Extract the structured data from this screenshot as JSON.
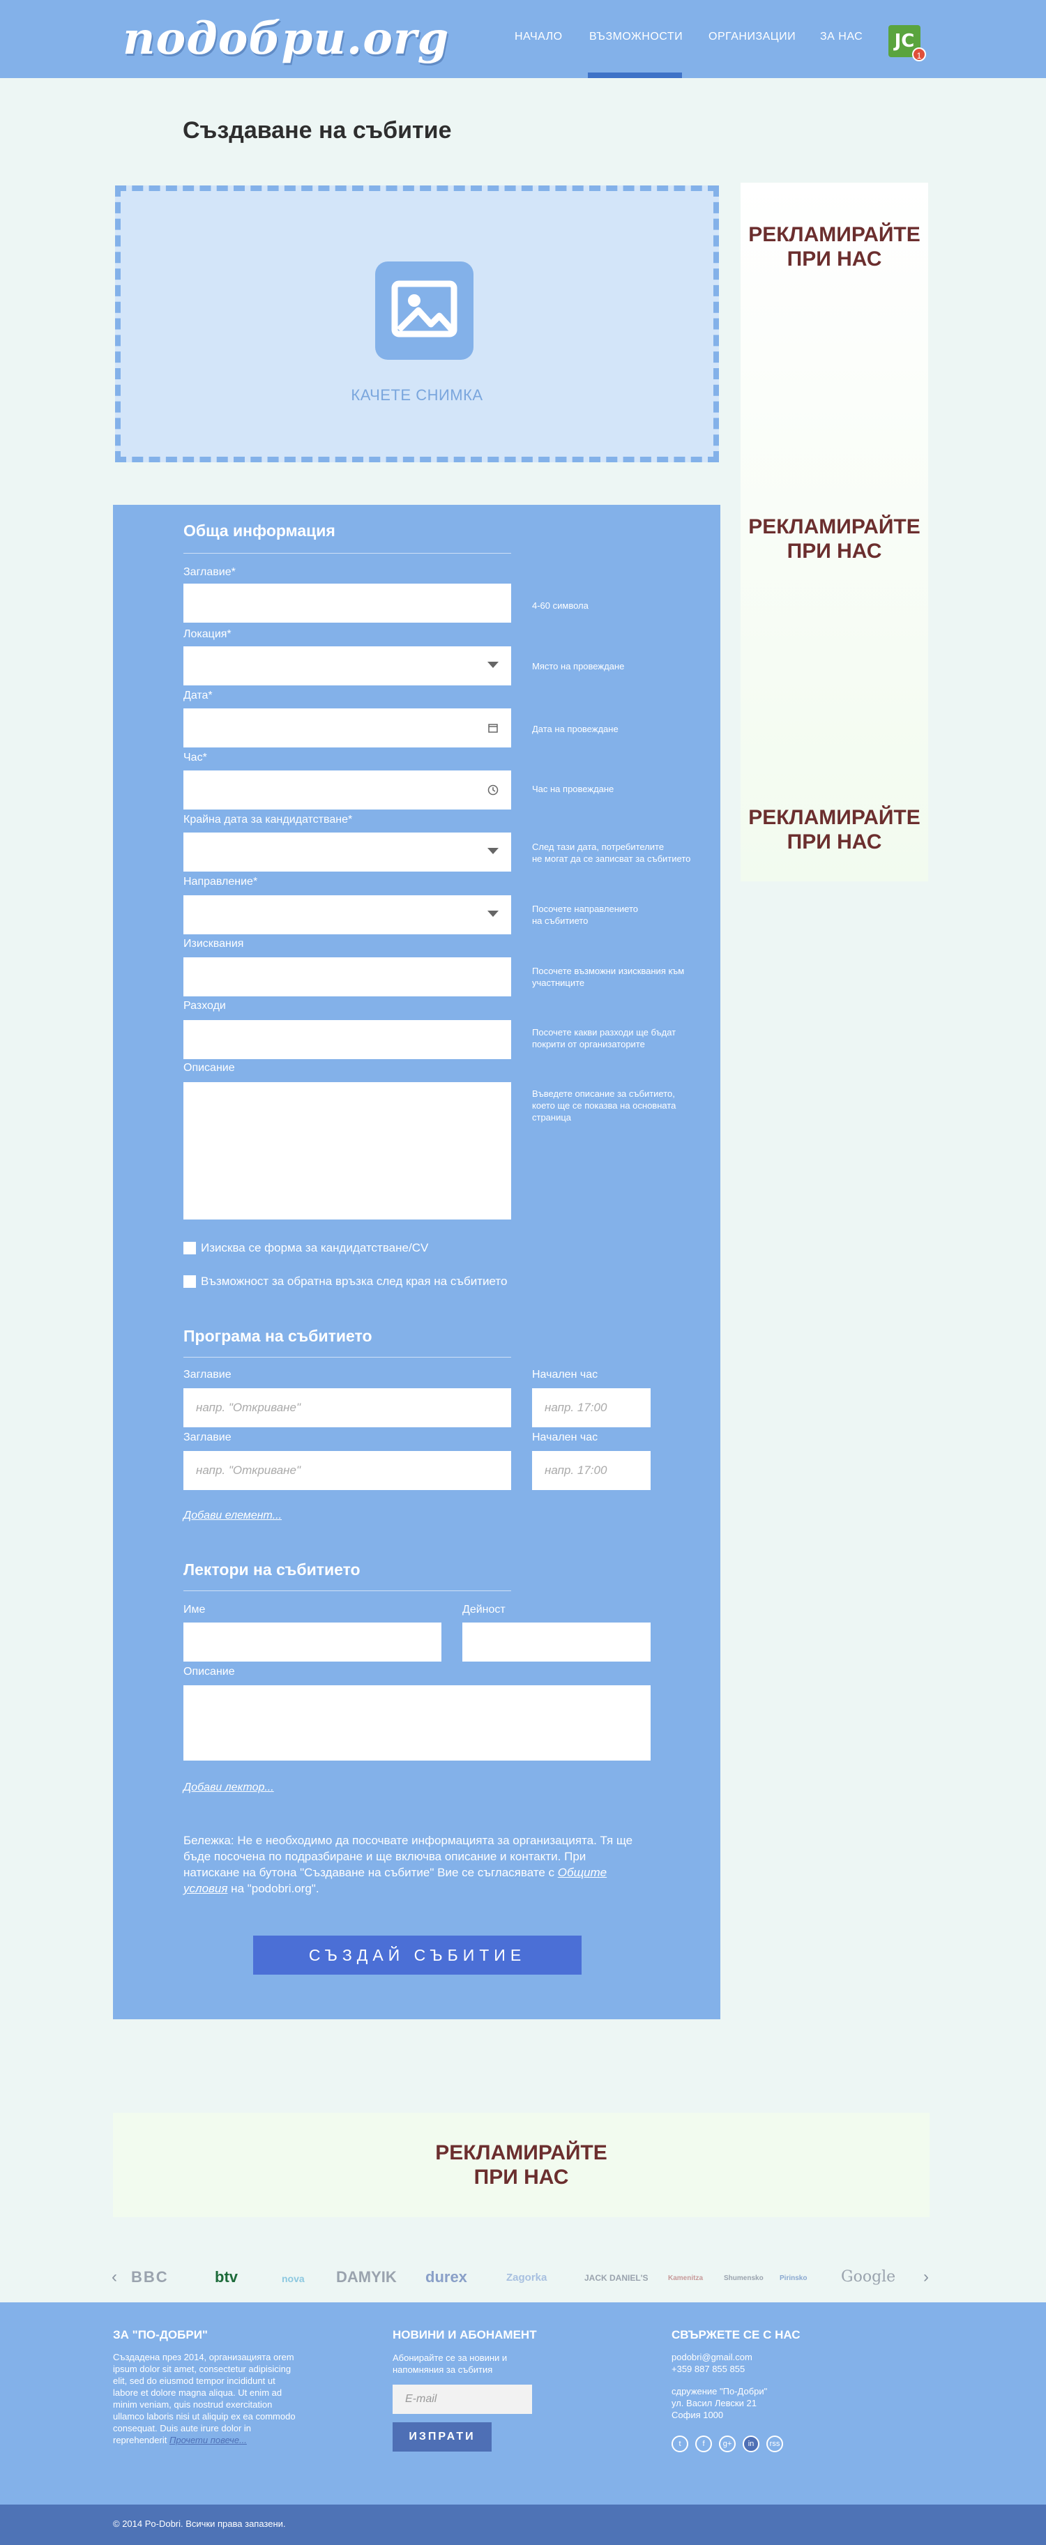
{
  "header": {
    "logo": "подобри.org",
    "nav": [
      "НАЧАЛО",
      "ВЪЗМОЖНОСТИ",
      "ОРГАНИЗАЦИИ",
      "ЗА НАС"
    ],
    "avatar_initials": "JC",
    "notification_count": "1"
  },
  "page_title": "Създаване на събитие",
  "upload": {
    "label": "КАЧЕТЕ СНИМКА"
  },
  "ads": {
    "text_line1": "РЕКЛАМИРАЙТЕ",
    "text_line2": "ПРИ НАС"
  },
  "general": {
    "title": "Обща информация",
    "fields": [
      {
        "label": "Заглавие*",
        "hint": "4-60 символа"
      },
      {
        "label": "Локация*",
        "hint": "Място на провеждане"
      },
      {
        "label": "Дата*",
        "hint": "Дата на провеждане"
      },
      {
        "label": "Час*",
        "hint": "Час на провеждане"
      },
      {
        "label": "Крайна дата за кандидатстване*",
        "hint": "След тази дата, потребителите\nне могат да се записват за събитието"
      },
      {
        "label": "Направление*",
        "hint": "Посочете направлението\nна събитието"
      },
      {
        "label": "Изисквания",
        "hint": "Посочете възможни изисквания към\nучастниците"
      },
      {
        "label": "Разходи",
        "hint": "Посочете какви разходи ще бъдат\nпокрити от организаторите"
      },
      {
        "label": "Описание",
        "hint": "Въведете описание за събитието,\nкоето ще се показва на основната\nстраница"
      }
    ],
    "checkbox1": "Изисква се форма за кандидатстване/CV",
    "checkbox2": "Възможност за обратна връзка след края на събитието"
  },
  "program": {
    "title": "Програма на събитието",
    "title_label": "Заглавие",
    "time_label": "Начален час",
    "title_placeholder": "напр. \"Откриване\"",
    "time_placeholder": "напр. 17:00",
    "add_link": "Добави елемент..."
  },
  "lecturers": {
    "title": "Лектори на събитието",
    "name_label": "Име",
    "activity_label": "Дейност",
    "description_label": "Описание",
    "add_link": "Добави лектор..."
  },
  "note": {
    "text": "Бележка: Не е необходимо да посочвате информацията за организацията. Тя ще бъде посочена по подразбиране и ще включва описание и контакти. При натискане на бутона \"Създаване на събитие\" Вие се съгласявате с ",
    "link": "Общите условия",
    "suffix": " на \"podobri.org\"."
  },
  "submit_label": "СЪЗДАЙ СЪБИТИЕ",
  "partners": [
    "BBC",
    "btv",
    "nova",
    "DAMYIK",
    "durex",
    "Zagorka",
    "JACK DANIEL'S",
    "Kamenitza",
    "Shumensko",
    "Pirinsko",
    "Google"
  ],
  "footer": {
    "about_title": "ЗА \"ПО-ДОБРИ\"",
    "about_text": "Създадена през 2014, организацията orem ipsum dolor sit amet, consectetur adipisicing elit, sed do eiusmod tempor incididunt ut labore et dolore magna aliqua. Ut enim ad minim veniam, quis nostrud exercitation ullamco laboris nisi ut aliquip ex ea commodo consequat. Duis aute irure dolor in reprehenderit",
    "about_more": "Прочети повече...",
    "news_title": "НОВИНИ И АБОНАМЕНТ",
    "news_text": "Абонирайте се за новини и напомняния за събития",
    "email_placeholder": "E-mail",
    "subscribe_label": "ИЗПРАТИ",
    "contact_title": "СВЪРЖЕТЕ СЕ С НАС",
    "email": "podobri@gmail.com",
    "phone": "+359 887 855 855",
    "org": "сдружение \"По-Добри\"",
    "street": "ул. Васил Левски 21",
    "city": "София 1000",
    "social": [
      "t",
      "f",
      "g+",
      "in",
      "rss"
    ],
    "copyright": "© 2014 Po-Dobri. Всички права запазени."
  }
}
